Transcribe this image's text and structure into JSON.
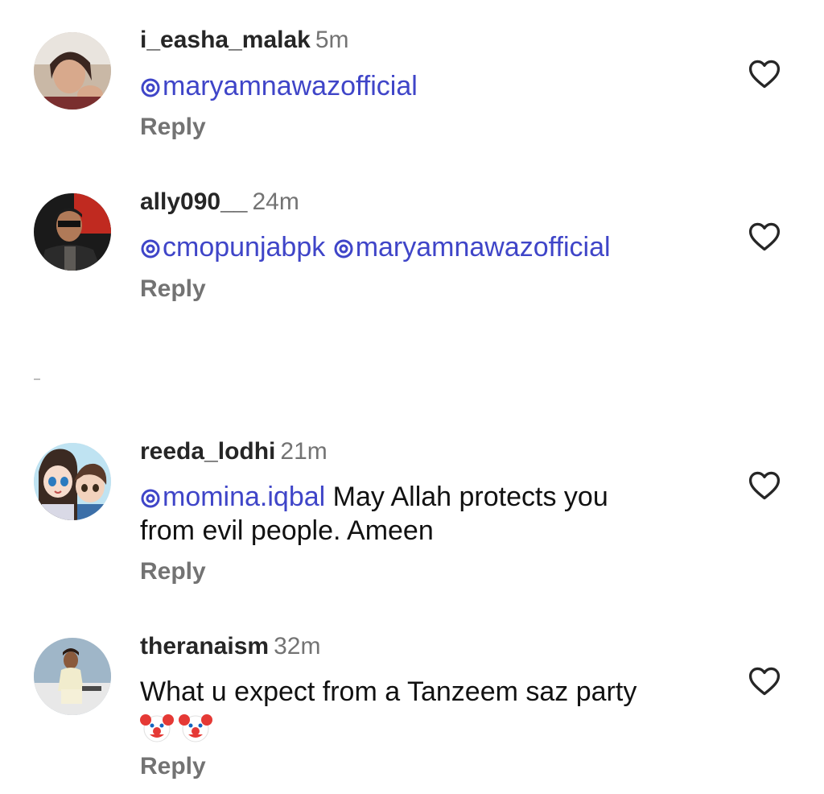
{
  "comments": [
    {
      "username": "i_easha_malak",
      "time": "5m",
      "mentions": [
        "maryamnawazofficial"
      ],
      "text": "",
      "reply_label": "Reply",
      "avatar_icon": "profile-photo"
    },
    {
      "username": "ally090__",
      "time": "24m",
      "mentions": [
        "cmopunjabpk",
        "maryamnawazofficial"
      ],
      "text": "",
      "reply_label": "Reply",
      "avatar_icon": "profile-photo"
    },
    {
      "username": "reeda_lodhi",
      "time": "21m",
      "mentions": [
        "momina.iqbal"
      ],
      "text_line1": "May Allah protects you",
      "text_line2": "from evil people. Ameen",
      "reply_label": "Reply",
      "avatar_icon": "cartoon-profile-photo"
    },
    {
      "username": "theranaism",
      "time": "32m",
      "mentions": [],
      "text": "What u expect from a Tanzeem saz party",
      "emojis": [
        "clown-face-emoji",
        "clown-face-emoji"
      ],
      "reply_label": "Reply",
      "avatar_icon": "profile-photo"
    }
  ],
  "colors": {
    "mention": "#3f45c8",
    "username": "#262626",
    "muted": "#737373",
    "background": "#ffffff"
  }
}
